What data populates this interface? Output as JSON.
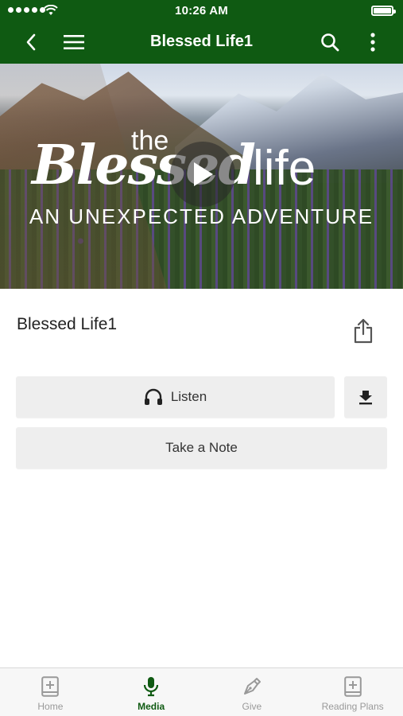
{
  "status_bar": {
    "time": "10:26 AM"
  },
  "nav": {
    "title": "Blessed Life1",
    "back_icon": "chevron-left-icon",
    "menu_icon": "hamburger-icon",
    "search_icon": "search-icon",
    "more_icon": "more-vertical-icon"
  },
  "hero": {
    "title_the": "the",
    "title_main": "Bless",
    "title_main2": "ed",
    "title_life": "life",
    "subtitle": "AN UNEXPECTED ADVENTURE",
    "play_icon": "play-icon"
  },
  "media": {
    "title": "Blessed Life1",
    "share_icon": "share-icon",
    "listen_label": "Listen",
    "listen_icon": "headphones-icon",
    "download_icon": "download-icon",
    "note_label": "Take a Note"
  },
  "tabs": [
    {
      "label": "Home",
      "icon": "book-plus-icon",
      "active": false
    },
    {
      "label": "Media",
      "icon": "microphone-icon",
      "active": true
    },
    {
      "label": "Give",
      "icon": "pen-nib-icon",
      "active": false
    },
    {
      "label": "Reading Plans",
      "icon": "book-plus-icon",
      "active": false
    }
  ],
  "colors": {
    "brand_green": "#0f5a12",
    "button_gray": "#eeeeee",
    "tab_inactive": "#999999"
  }
}
